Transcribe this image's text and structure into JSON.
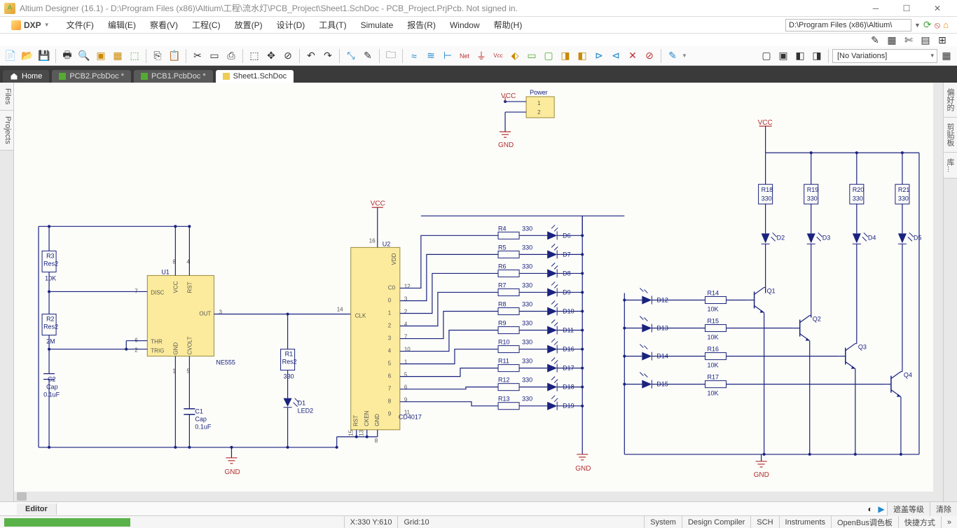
{
  "window": {
    "title": "Altium Designer (16.1) - D:\\Program Files (x86)\\Altium\\工程\\流水灯\\PCB_Project\\Sheet1.SchDoc - PCB_Project.PrjPcb. Not signed in."
  },
  "dxp_label": "DXP",
  "menus": [
    "文件(F)",
    "编辑(E)",
    "察看(V)",
    "工程(C)",
    "放置(P)",
    "设计(D)",
    "工具(T)",
    "Simulate",
    "报告(R)",
    "Window",
    "帮助(H)"
  ],
  "path_box": "D:\\Program Files (x86)\\Altium\\",
  "variation": "[No Variations]",
  "tabs": {
    "home": "Home",
    "docs": [
      {
        "label": "PCB2.PcbDoc *",
        "active": false
      },
      {
        "label": "PCB1.PcbDoc *",
        "active": false
      },
      {
        "label": "Sheet1.SchDoc",
        "active": true
      }
    ]
  },
  "side_left": [
    "Files",
    "Projects"
  ],
  "side_right": [
    "偏好的",
    "剪贴板",
    "库..."
  ],
  "bottom": {
    "editor": "Editor",
    "mask": "遮盖等级",
    "clear": "清除"
  },
  "status": {
    "coord": "X:330 Y:610",
    "grid": "Grid:10",
    "panels": [
      "System",
      "Design Compiler",
      "SCH",
      "Instruments",
      "OpenBus调色板",
      "快捷方式"
    ]
  },
  "schematic": {
    "power": {
      "name": "Power",
      "pins": [
        "1",
        "2"
      ],
      "vcc": "VCC",
      "gnd": "GND"
    },
    "u1": {
      "ref": "U1",
      "type": "NE555",
      "pins_left": [
        "DISC",
        "THR",
        "TRIG"
      ],
      "pins_right": [
        "VCC",
        "RST",
        "OUT",
        "GND",
        "CVOLT"
      ],
      "nums": {
        "disc": "7",
        "thr": "6",
        "trig": "2",
        "out": "3"
      }
    },
    "u2": {
      "ref": "U2",
      "type": "CD4017",
      "clk": "CLK",
      "vdd": "VDD",
      "rst": "RST",
      "cken": "CKEN",
      "gnd": "GND",
      "outs": [
        "C0",
        "0",
        "1",
        "2",
        "3",
        "4",
        "5",
        "6",
        "7",
        "8",
        "9"
      ],
      "pins": [
        "12",
        "3",
        "2",
        "4",
        "7",
        "10",
        "1",
        "5",
        "6",
        "9",
        "11"
      ],
      "vdd_pin": "16",
      "clk_pin": "14",
      "bottom_pins": [
        "15",
        "13",
        "8"
      ]
    },
    "r_net": {
      "r2": {
        "ref": "R2",
        "val": "Res2",
        "val2": "2M"
      },
      "r3": {
        "ref": "R3",
        "val": "Res2",
        "val2": "10K"
      }
    },
    "c1": {
      "ref": "C1",
      "val": "Cap",
      "val2": "0.1uF"
    },
    "c2": {
      "ref": "C2",
      "val": "Cap",
      "val2": "0.1uF"
    },
    "r1": {
      "ref": "R1",
      "val": "Res2",
      "val2": "330"
    },
    "d1": {
      "ref": "D1",
      "val": "LED2"
    },
    "r_series_a": [
      {
        "ref": "R4",
        "val": "330"
      },
      {
        "ref": "R5",
        "val": "330"
      },
      {
        "ref": "R6",
        "val": "330"
      },
      {
        "ref": "R7",
        "val": "330"
      },
      {
        "ref": "R8",
        "val": "330"
      },
      {
        "ref": "R9",
        "val": "330"
      },
      {
        "ref": "R10",
        "val": "330"
      },
      {
        "ref": "R11",
        "val": "330"
      },
      {
        "ref": "R12",
        "val": "330"
      },
      {
        "ref": "R13",
        "val": "330"
      }
    ],
    "d_series_a": [
      "D6",
      "D7",
      "D8",
      "D9",
      "D10",
      "D11",
      "D16",
      "D17",
      "D18",
      "D19"
    ],
    "r_top": [
      {
        "ref": "R18",
        "val": "330"
      },
      {
        "ref": "R19",
        "val": "330"
      },
      {
        "ref": "R20",
        "val": "330"
      },
      {
        "ref": "R21",
        "val": "330"
      }
    ],
    "d_top": [
      "D2",
      "D3",
      "D4",
      "D5"
    ],
    "d_side": [
      "D12",
      "D13",
      "D14",
      "D15"
    ],
    "r_side": [
      {
        "ref": "R14",
        "val": "10K"
      },
      {
        "ref": "R15",
        "val": "10K"
      },
      {
        "ref": "R16",
        "val": "10K"
      },
      {
        "ref": "R17",
        "val": "10K"
      }
    ],
    "q": [
      "Q1",
      "Q2",
      "Q3",
      "Q4"
    ],
    "vcc": "VCC",
    "gnd": "GND"
  }
}
